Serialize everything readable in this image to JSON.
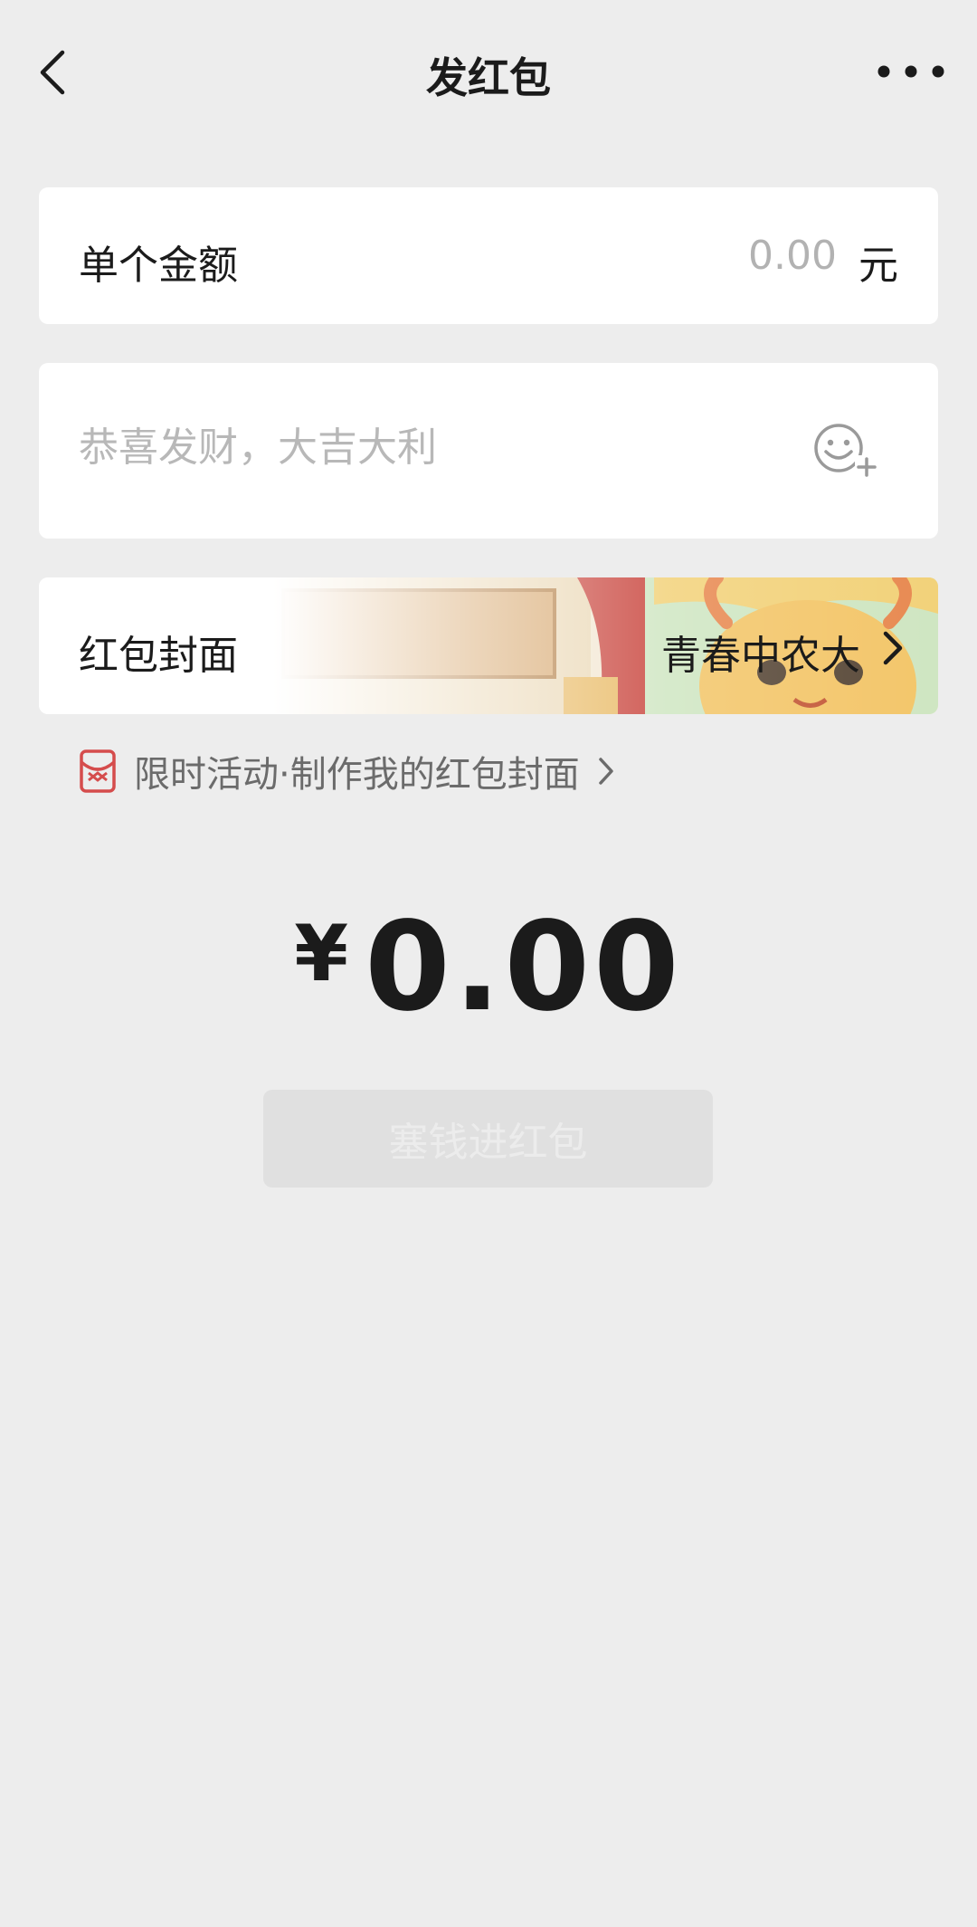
{
  "header": {
    "title": "发红包",
    "back_icon": "chevron-left-icon",
    "more_icon": "more-dots-icon"
  },
  "amount_row": {
    "label": "单个金额",
    "value": "0.00",
    "unit": "元"
  },
  "greeting": {
    "placeholder": "恭喜发财，大吉大利",
    "value": "",
    "emoji_icon": "emoji-add-icon"
  },
  "cover_row": {
    "label": "红包封面",
    "selected_cover": "青春中农大"
  },
  "promo": {
    "text": "限时活动·制作我的红包封面",
    "icon": "red-envelope-icon",
    "accent_color": "#d54c4c"
  },
  "total": {
    "currency": "¥",
    "amount": "0.00"
  },
  "submit": {
    "label": "塞钱进红包",
    "enabled": false
  }
}
